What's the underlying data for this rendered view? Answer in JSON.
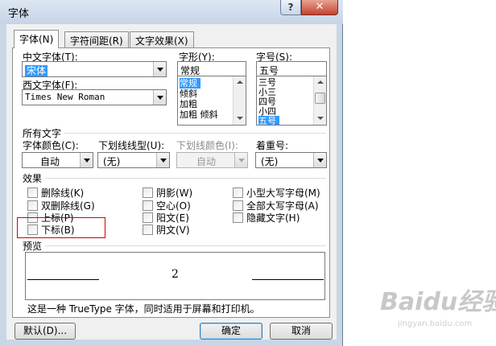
{
  "window": {
    "title": "字体",
    "help_glyph": "?",
    "close_glyph": "✕"
  },
  "tabs": [
    {
      "label": "字体(N)",
      "active": true
    },
    {
      "label": "字符间距(R)",
      "active": false
    },
    {
      "label": "文字效果(X)",
      "active": false
    }
  ],
  "font": {
    "chinese_label": "中文字体(T):",
    "chinese_value": "宋体",
    "western_label": "西文字体(F):",
    "western_value": "Times New Roman",
    "style_label": "字形(Y):",
    "style_value": "常规",
    "style_options": [
      "常规",
      "倾斜",
      "加粗",
      "加粗 倾斜"
    ],
    "style_selected": "常规",
    "size_label": "字号(S):",
    "size_value": "五号",
    "size_options": [
      "三号",
      "小三",
      "四号",
      "小四",
      "五号"
    ],
    "size_selected": "五号"
  },
  "all_text": {
    "section_label": "所有文字",
    "color_label": "字体颜色(C):",
    "color_value": "自动",
    "underline_label": "下划线线型(U):",
    "underline_value": "(无)",
    "underline_color_label": "下划线颜色(I):",
    "underline_color_value": "自动",
    "emphasis_label": "着重号:",
    "emphasis_value": "(无)"
  },
  "effects": {
    "section_label": "效果",
    "col1": [
      "删除线(K)",
      "双删除线(G)",
      "上标(P)",
      "下标(B)"
    ],
    "col2": [
      "阴影(W)",
      "空心(O)",
      "阳文(E)",
      "阴文(V)"
    ],
    "col3": [
      "小型大写字母(M)",
      "全部大写字母(A)",
      "隐藏文字(H)"
    ]
  },
  "preview": {
    "section_label": "预览",
    "sample_text": "2",
    "note": "这是一种 TrueType 字体，同时适用于屏幕和打印机。"
  },
  "buttons": {
    "default": "默认(D)...",
    "ok": "确定",
    "cancel": "取消"
  },
  "watermark": {
    "main": "Baidu经验",
    "sub": "jingyan.baidu.com"
  },
  "colors": {
    "highlight": "#3399ff",
    "annotation_box": "#d40000",
    "close_button": "#c8412c"
  }
}
